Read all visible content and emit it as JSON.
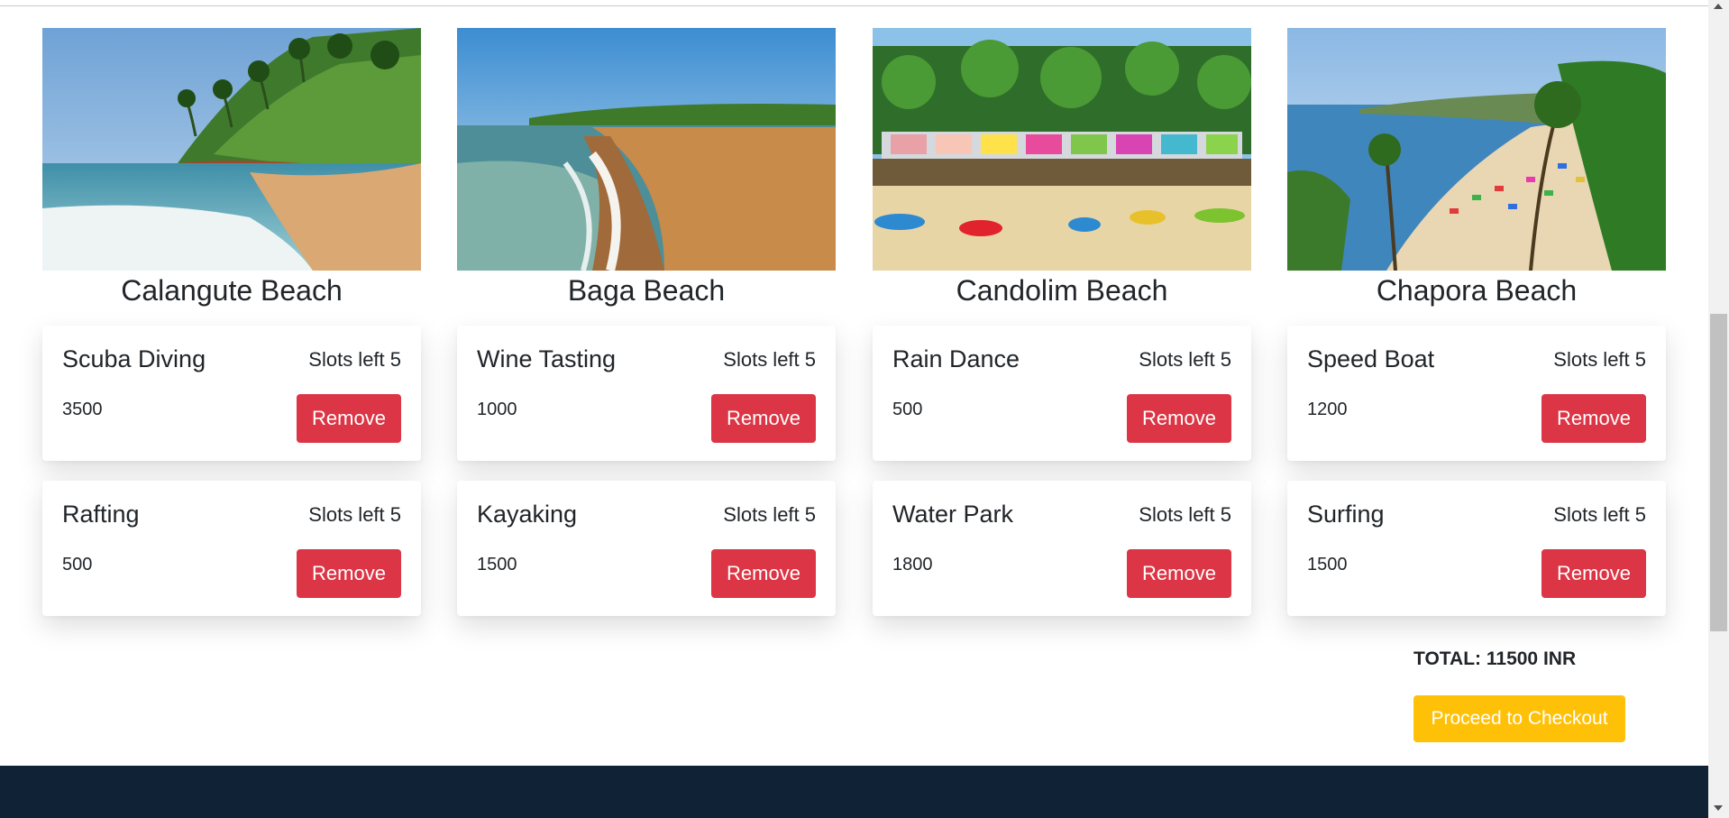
{
  "beaches": [
    {
      "name": "Calangute Beach",
      "image": "beach-photo-rocky-hill"
    },
    {
      "name": "Baga Beach",
      "image": "beach-photo-waves"
    },
    {
      "name": "Candolim Beach",
      "image": "beach-photo-huts-kayaks"
    },
    {
      "name": "Chapora Beach",
      "image": "beach-photo-aerial-umbrellas"
    }
  ],
  "activities_row1": [
    {
      "title": "Scuba Diving",
      "slots": "Slots left 5",
      "price": "3500",
      "remove_label": "Remove"
    },
    {
      "title": "Wine Tasting",
      "slots": "Slots left 5",
      "price": "1000",
      "remove_label": "Remove"
    },
    {
      "title": "Rain Dance",
      "slots": "Slots left 5",
      "price": "500",
      "remove_label": "Remove"
    },
    {
      "title": "Speed Boat",
      "slots": "Slots left 5",
      "price": "1200",
      "remove_label": "Remove"
    }
  ],
  "activities_row2": [
    {
      "title": "Rafting",
      "slots": "Slots left 5",
      "price": "500",
      "remove_label": "Remove"
    },
    {
      "title": "Kayaking",
      "slots": "Slots left 5",
      "price": "1500",
      "remove_label": "Remove"
    },
    {
      "title": "Water Park",
      "slots": "Slots left 5",
      "price": "1800",
      "remove_label": "Remove"
    },
    {
      "title": "Surfing",
      "slots": "Slots left 5",
      "price": "1500",
      "remove_label": "Remove"
    }
  ],
  "cart": {
    "total": "TOTAL: 11500 INR",
    "checkout_label": "Proceed to Checkout"
  },
  "colors": {
    "remove": "#dc3545",
    "checkout": "#ffc107",
    "footer": "#0f2236"
  }
}
